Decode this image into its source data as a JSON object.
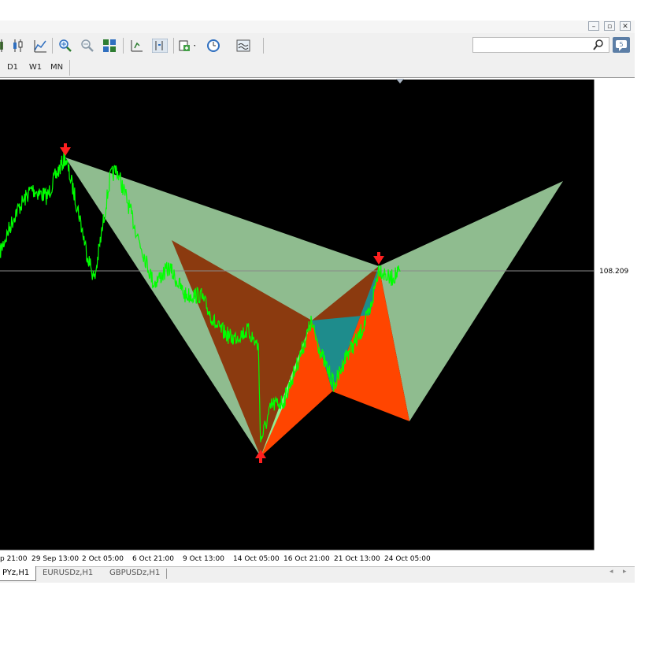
{
  "window": {
    "buttons": [
      "–",
      "▫",
      "✕"
    ]
  },
  "toolbar": {
    "icons": [
      "candlestick-chart-icon",
      "line-chart-icon",
      "zoom-in-icon",
      "zoom-out-icon",
      "tile-windows-icon",
      "chart-shift-icon",
      "autoscroll-icon",
      "indicators-icon",
      "periodicity-clock-icon",
      "templates-icon"
    ]
  },
  "search": {
    "placeholder": ""
  },
  "timeframes": [
    "D1",
    "W1",
    "MN"
  ],
  "chart_data": {
    "type": "line",
    "y_ticks": [
      "110.866",
      "110.446",
      "110.026",
      "109.606",
      "109.186",
      "108.766",
      "108.346",
      "107.926",
      "107.506",
      "107.086",
      "106.666",
      "106.246",
      "105.826",
      "105.406",
      "104.986",
      "104.566",
      "104.146",
      "103.726"
    ],
    "current_price": "108.209",
    "x_ticks": [
      "p 21:00",
      "29 Sep 13:00",
      "2 Oct 05:00",
      "6 Oct 21:00",
      "9 Oct 13:00",
      "14 Oct 05:00",
      "16 Oct 21:00",
      "21 Oct 13:00",
      "24 Oct 05:00"
    ],
    "ylim": [
      103.726,
      110.866
    ],
    "colors": {
      "background": "#000000",
      "price_line": "#00ff00",
      "outer_pattern": "#8fbc8f",
      "inner_pattern": "#8b3a0f",
      "bright_triangle": "#ff4500",
      "teal_triangle": "#1e8c8c",
      "light_triangle": "#90ee90",
      "arrow": "#ff2020",
      "axis_text": "#ffffff"
    }
  },
  "tabs": [
    "PYz,H1",
    "EURUSDz,H1",
    "GBPUSDz,H1"
  ],
  "tab_arrows": [
    "◂",
    "▸"
  ]
}
